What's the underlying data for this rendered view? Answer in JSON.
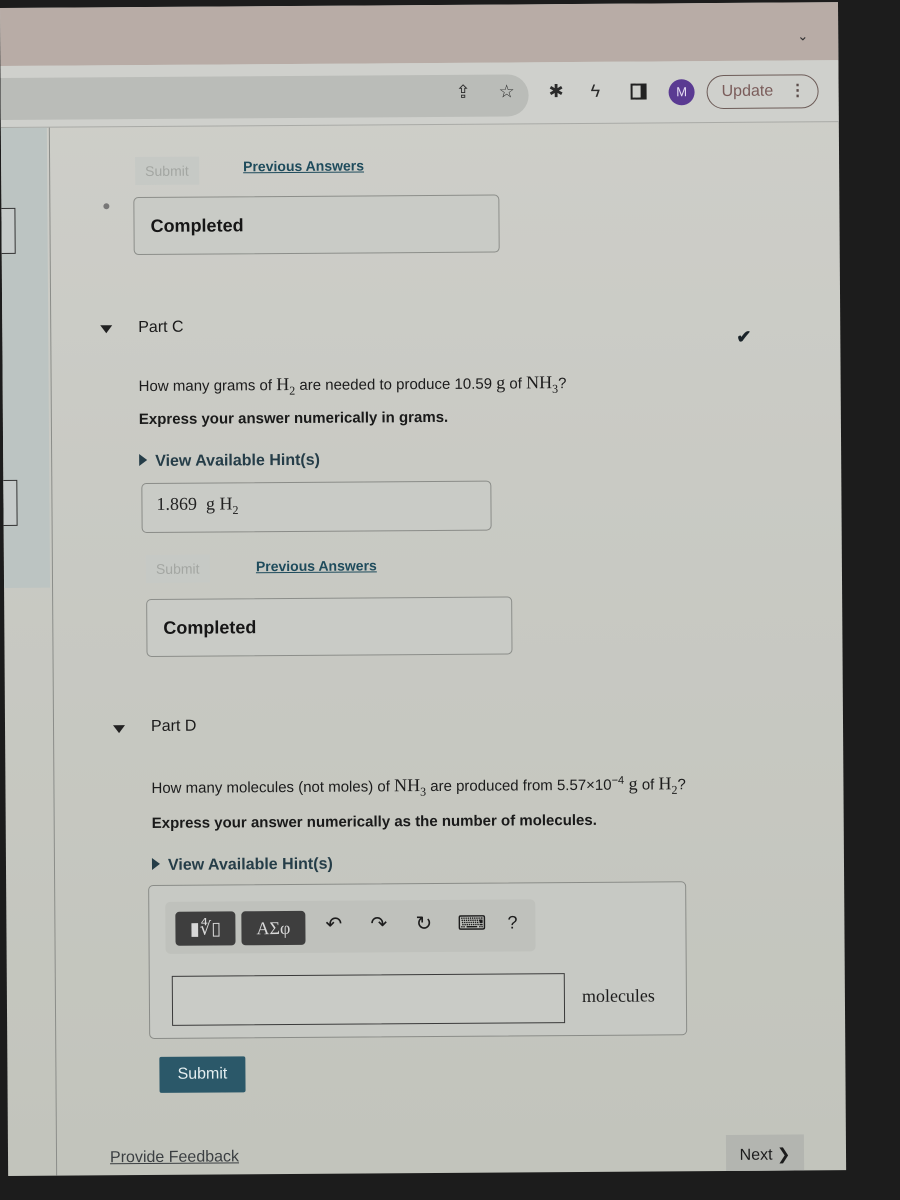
{
  "browser": {
    "toolbar_icons": [
      "share-icon",
      "star-icon",
      "extensions-icon",
      "leaf-bolt-icon",
      "sidepanel-icon"
    ],
    "profile_initial": "M",
    "update_label": "Update",
    "tabstrip_chevron": "⌄"
  },
  "part_b_tail": {
    "submit_label": "Submit",
    "previous_answers_label": "Previous Answers",
    "status": "Completed"
  },
  "part_c": {
    "title": "Part C",
    "question_prefix": "How many grams of ",
    "question_species_1": "H",
    "question_species_1_sub": "2",
    "question_middle": " are needed to produce 10.59 ",
    "question_unit": "g",
    "question_of": " of ",
    "question_species_2": "NH",
    "question_species_2_sub": "3",
    "question_suffix": "?",
    "instruction": "Express your answer numerically in grams.",
    "hint_label": "View Available Hint(s)",
    "answer_value": "1.869",
    "answer_unit": "g H",
    "answer_unit_sub": "2",
    "submit_label": "Submit",
    "previous_answers_label": "Previous Answers",
    "status": "Completed"
  },
  "part_d": {
    "title": "Part D",
    "question_prefix": "How many molecules (not moles) of ",
    "question_species_1": "NH",
    "question_species_1_sub": "3",
    "question_middle": " are produced from 5.57×10",
    "question_exponent": "−4",
    "question_unit": " g",
    "question_of": " of ",
    "question_species_2": "H",
    "question_species_2_sub": "2",
    "question_suffix": "?",
    "instruction": "Express your answer numerically as the number of molecules.",
    "hint_label": "View Available Hint(s)",
    "math_toolbar": {
      "templates_label": "▮∜▯",
      "symbols_label": "ΑΣφ",
      "undo": "↶",
      "redo": "↷",
      "reset": "↻",
      "keyboard": "⌨",
      "help": "?"
    },
    "answer_value": "",
    "unit_label": "molecules",
    "submit_label": "Submit"
  },
  "footer": {
    "feedback_label": "Provide Feedback",
    "next_label": "Next ❯"
  }
}
